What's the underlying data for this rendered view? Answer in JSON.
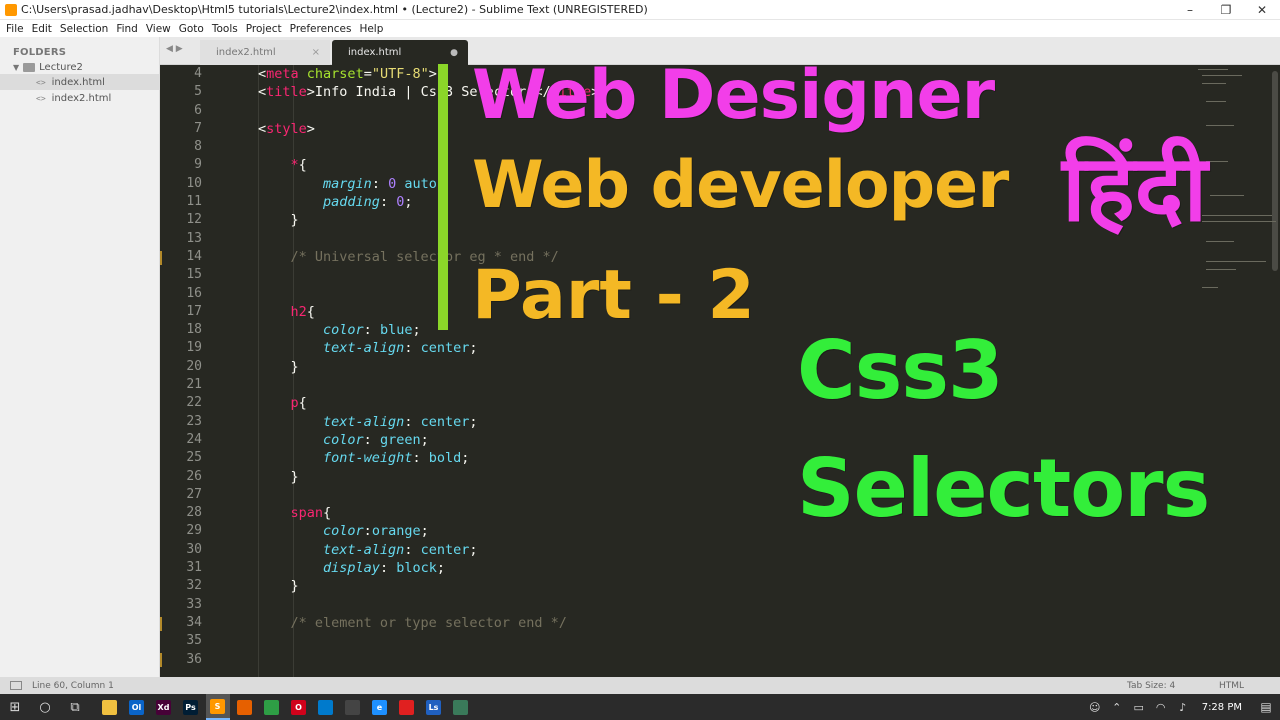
{
  "window": {
    "title": "C:\\Users\\prasad.jadhav\\Desktop\\Html5 tutorials\\Lecture2\\index.html • (Lecture2) - Sublime Text (UNREGISTERED)",
    "controls": [
      "–",
      "❐",
      "✕"
    ]
  },
  "menu": [
    "File",
    "Edit",
    "Selection",
    "Find",
    "View",
    "Goto",
    "Tools",
    "Project",
    "Preferences",
    "Help"
  ],
  "sidebar": {
    "header": "FOLDERS",
    "folder": "Lecture2",
    "files": [
      {
        "name": "index.html",
        "active": true
      },
      {
        "name": "index2.html",
        "active": false
      }
    ]
  },
  "tabs": [
    {
      "label": "index2.html",
      "close": "×",
      "active": false
    },
    {
      "label": "index.html",
      "close": "●",
      "active": true
    }
  ],
  "editor": {
    "line_numbers": [
      "4",
      "5",
      "6",
      "7",
      "8",
      "9",
      "10",
      "11",
      "12",
      "13",
      "14",
      "15",
      "16",
      "17",
      "18",
      "19",
      "20",
      "21",
      "22",
      "23",
      "24",
      "25",
      "26",
      "27",
      "28",
      "29",
      "30",
      "31",
      "32",
      "33",
      "34",
      "35",
      "36"
    ]
  },
  "overlay": {
    "line1": "Web Designer",
    "line2": "Web developer",
    "hindi": "हिंदी",
    "line3": "Part - 2",
    "line4": "Css3",
    "line5": "Selectors",
    "colors": {
      "magenta": "#f23ee9",
      "orange": "#f4b825",
      "green": "#33ee3a",
      "bar": "#8bd629"
    }
  },
  "status": {
    "position": "Line 60, Column 1",
    "tab_size": "Tab Size: 4",
    "syntax": "HTML"
  },
  "taskbar": {
    "clock": "7:28 PM",
    "apps": [
      {
        "name": "file-explorer",
        "color": "#f0c040",
        "label": ""
      },
      {
        "name": "outlook",
        "color": "#0a64c8",
        "label": "Ol"
      },
      {
        "name": "adobe-xd",
        "color": "#470137",
        "label": "Xd"
      },
      {
        "name": "photoshop",
        "color": "#001d34",
        "label": "Ps"
      },
      {
        "name": "sublime-text",
        "color": "#ff9800",
        "label": "S"
      },
      {
        "name": "firefox",
        "color": "#e66000",
        "label": ""
      },
      {
        "name": "chrome",
        "color": "#2e9e45",
        "label": ""
      },
      {
        "name": "opera",
        "color": "#d0021b",
        "label": "O"
      },
      {
        "name": "vscode",
        "color": "#007acc",
        "label": ""
      },
      {
        "name": "terminal",
        "color": "#444444",
        "label": ""
      },
      {
        "name": "edge",
        "color": "#1e90ff",
        "label": "e"
      },
      {
        "name": "generic-red",
        "color": "#e02020",
        "label": ""
      },
      {
        "name": "generic-blue",
        "color": "#2060c0",
        "label": "Ls"
      },
      {
        "name": "generic-green",
        "color": "#3a7a5a",
        "label": ""
      }
    ]
  }
}
